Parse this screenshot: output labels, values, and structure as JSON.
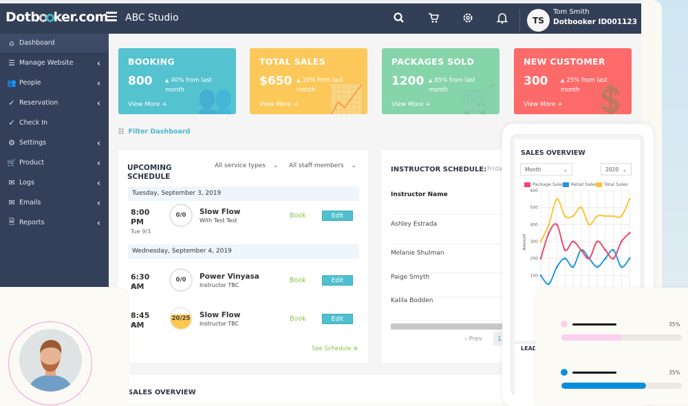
{
  "header": {
    "logo": "Dotbooker.com",
    "studio": "ABC Studio",
    "user_initials": "TS",
    "user_name": "Tom Smith",
    "user_id": "Dotbooker ID001123",
    "icons": [
      "search-icon",
      "cart-icon",
      "gear-icon",
      "bell-icon"
    ]
  },
  "sidebar": {
    "items": [
      {
        "label": "Dashboard",
        "icon": "home-icon",
        "active": true
      },
      {
        "label": "Manage Website",
        "icon": "list-icon"
      },
      {
        "label": "People",
        "icon": "people-icon"
      },
      {
        "label": "Reservation",
        "icon": "check-circle-icon"
      },
      {
        "label": "Check In",
        "icon": "check-circle-icon"
      },
      {
        "label": "Settings",
        "icon": "gear-icon"
      },
      {
        "label": "Product",
        "icon": "cart-icon"
      },
      {
        "label": "Logs",
        "icon": "mail-icon"
      },
      {
        "label": "Emails",
        "icon": "mail-icon"
      },
      {
        "label": "Reports",
        "icon": "file-icon"
      }
    ]
  },
  "cards": [
    {
      "title": "BOOKING",
      "value": "800",
      "delta": "40% from last month",
      "more": "View More +",
      "color": "#55c2d0"
    },
    {
      "title": "TOTAL SALES",
      "value": "$650",
      "delta": "10% from last month",
      "more": "View More +",
      "color": "#fcc85a"
    },
    {
      "title": "PACKAGES SOLD",
      "value": "1200",
      "delta": "85% from last month",
      "more": "View More +",
      "color": "#86d4aa"
    },
    {
      "title": "NEW CUSTOMER",
      "value": "300",
      "delta": "25% from last month",
      "more": "View More +",
      "color": "#fc6b6a"
    }
  ],
  "filter_label": "Filter Dashboard",
  "upcoming": {
    "title": "UPCOMING SCHEDULE",
    "service_filter": "All service types",
    "staff_filter": "All staff members",
    "days": [
      "Tuesday, September 3, 2019",
      "Wednesday, September 4, 2019"
    ],
    "classes": [
      {
        "time": "8:00 PM",
        "date": "Tue 9/3",
        "capacity": "0/0",
        "name": "Slow Flow",
        "instructor": "With Test Test"
      },
      {
        "time": "6:30 AM",
        "date": "9/4",
        "capacity": "0/0",
        "name": "Power Vinyasa",
        "instructor": "Instructor TBC"
      },
      {
        "time": "8:45 AM",
        "date": "9/4",
        "capacity": "20/25",
        "name": "Slow Flow",
        "instructor": "Instructor TBC"
      }
    ],
    "book_label": "Book",
    "edit_label": "Edit",
    "see_schedule": "See Schedule"
  },
  "instructor": {
    "title": "INSTRUCTOR SCHEDULE:",
    "day": "Frida",
    "column": "Instructor Name",
    "names": [
      "Ashley Estrada",
      "Melanie Shulman",
      "Paige Smyth",
      "Kalila Bodden"
    ],
    "prev": "Prev",
    "page": "1"
  },
  "sales_overview_bottom": "SALES OVERVIEW",
  "phone": {
    "title": "SALES OVERVIEW",
    "period": "Month",
    "year": "2020",
    "lead": "LEAD"
  },
  "chart_data": {
    "type": "line",
    "title": "SALES OVERVIEW",
    "ylabel": "Amount",
    "ylim": [
      0,
      600
    ],
    "yticks": [
      100,
      200,
      300,
      400,
      500,
      600
    ],
    "grid": true,
    "legend": "top",
    "series": [
      {
        "name": "Package Sales",
        "color": "#f0466b",
        "values": [
          200,
          350,
          400,
          250,
          300,
          250,
          200,
          300,
          250,
          200,
          300,
          350
        ]
      },
      {
        "name": "Retail Sales",
        "color": "#2196e0",
        "values": [
          100,
          50,
          150,
          200,
          150,
          250,
          200,
          150,
          200,
          250,
          150,
          200
        ]
      },
      {
        "name": "Total Sales",
        "color": "#fcc536",
        "values": [
          300,
          400,
          550,
          450,
          450,
          500,
          400,
          450,
          450,
          450,
          450,
          550
        ]
      }
    ]
  },
  "progress": [
    {
      "percent_label": "35%",
      "fill": 0.5,
      "color": "#fbd0ef"
    },
    {
      "percent_label": "35%",
      "fill": 0.7,
      "color": "#0a8fdc"
    }
  ]
}
